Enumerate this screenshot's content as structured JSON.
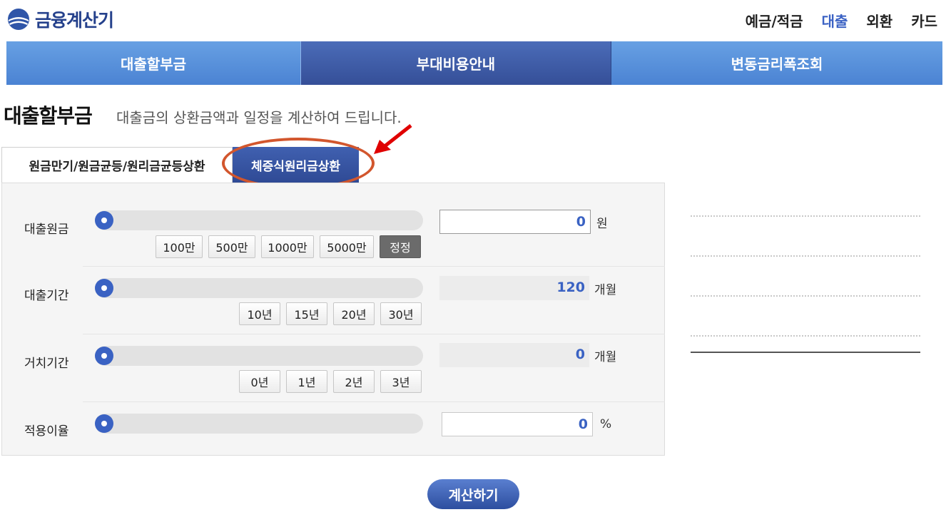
{
  "header": {
    "logo_text": "금융계산기",
    "nav": [
      "예금/적금",
      "대출",
      "외환",
      "카드"
    ],
    "nav_active": "대출"
  },
  "main_tabs": [
    "대출할부금",
    "부대비용안내",
    "변동금리폭조회"
  ],
  "main_tab_active": "부대비용안내",
  "page": {
    "title": "대출할부금",
    "subtitle": "대출금의 상환금액과 일정을 계산하여 드립니다."
  },
  "sub_tabs": [
    "원금만기/원금균등/원리금균등상환",
    "체증식원리금상환"
  ],
  "sub_tab_active": "체증식원리금상환",
  "form": {
    "principal": {
      "label": "대출원금",
      "value": "0",
      "unit": "원",
      "slider_level": 0,
      "chips": [
        "100만",
        "500만",
        "1000만",
        "5000만",
        "정정"
      ]
    },
    "period": {
      "label": "대출기간",
      "value": "120",
      "unit": "개월",
      "slider_level": 0,
      "chips": [
        "10년",
        "15년",
        "20년",
        "30년"
      ]
    },
    "grace": {
      "label": "거치기간",
      "value": "0",
      "unit": "개월",
      "slider_level": 0,
      "chips": [
        "0년",
        "1년",
        "2년",
        "3년"
      ]
    },
    "rate": {
      "label": "적용이율",
      "value": "0",
      "unit": "%",
      "slider_level": 0
    }
  },
  "calc_button": "계산하기",
  "colors": {
    "accent": "#3a62c3",
    "tab_blue": "#4b83d3",
    "tab_dark": "#354f98",
    "annotation": "#d2562d"
  }
}
